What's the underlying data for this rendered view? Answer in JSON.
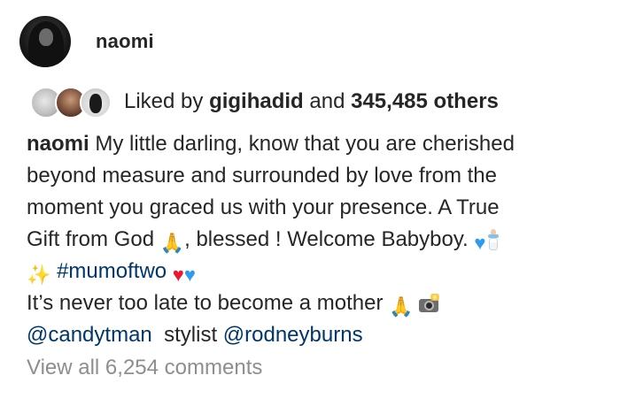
{
  "post": {
    "username": "naomi",
    "liked": {
      "prefix": "Liked by",
      "user": "gigihadid",
      "conjunction": "and",
      "count": "345,485 others"
    },
    "caption": {
      "author": "naomi",
      "line1": "My little darling, know that you are cherished",
      "line2": "beyond measure and surrounded by love from the",
      "line3": "moment you graced us with your presence. A True",
      "line4a": "Gift from God",
      "line4b": ", blessed ! Welcome Babyboy.",
      "hashtag": "#mumoftwo",
      "line6": " It’s never too late to become a mother",
      "mention1": "@candytman",
      "stylist_label": "stylist",
      "mention2": "@rodneyburns"
    },
    "view_all_comments": "View all 6,254 comments",
    "icons": {
      "pray": "folded-hands-icon",
      "blue_heart": "blue-heart-icon",
      "red_heart": "red-heart-icon",
      "bottle": "baby-bottle-icon",
      "sparkles": "sparkles-icon",
      "camera": "camera-flash-icon"
    },
    "colors": {
      "text": "#262626",
      "link": "#00376b",
      "muted": "#8e8e8e",
      "blue_heart": "#2f9bf0",
      "red_heart": "#e8192c"
    }
  }
}
